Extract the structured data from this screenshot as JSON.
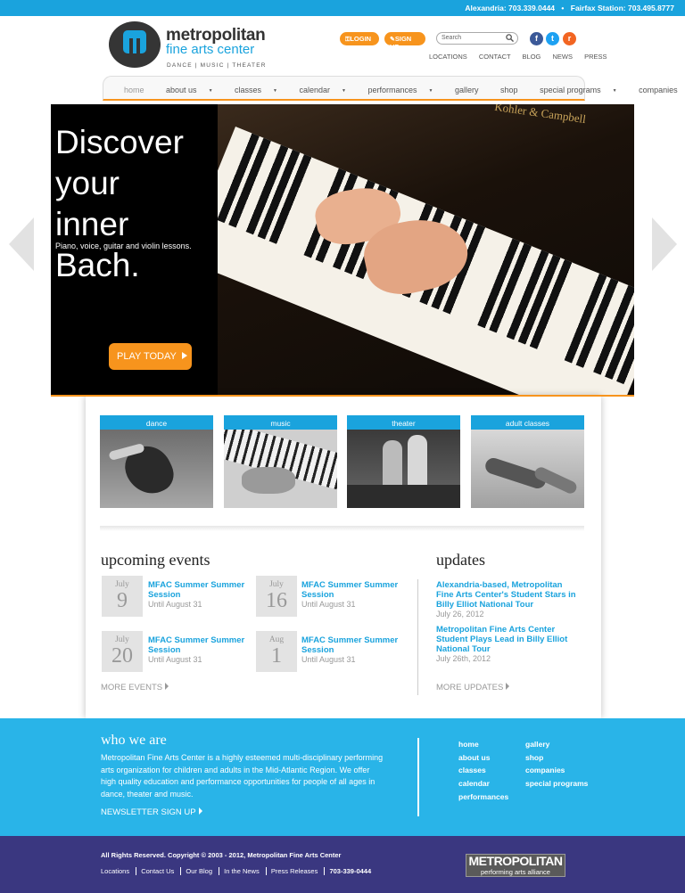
{
  "topbar": {
    "alexandria": "Alexandria: 703.339.0444",
    "separator": "•",
    "fairfax": "Fairfax Station: 703.495.8777"
  },
  "logo": {
    "name": "metropolitan",
    "subtitle": "fine arts center",
    "tagline": "DANCE | MUSIC | THEATER"
  },
  "header": {
    "login_label": "LOGIN",
    "signup_label": "SIGN UP",
    "search_placeholder": "Search",
    "social": {
      "facebook": "f",
      "twitter": "t",
      "rss": "r"
    },
    "util_links": [
      "LOCATIONS",
      "CONTACT",
      "BLOG",
      "NEWS",
      "PRESS"
    ]
  },
  "nav": {
    "items": [
      {
        "label": "home",
        "caret": ""
      },
      {
        "label": "about us",
        "caret": "▼"
      },
      {
        "label": "classes",
        "caret": "▼"
      },
      {
        "label": "calendar",
        "caret": "▼"
      },
      {
        "label": "performances",
        "caret": "▼"
      },
      {
        "label": "gallery",
        "caret": ""
      },
      {
        "label": "shop",
        "caret": ""
      },
      {
        "label": "special programs",
        "caret": "▼"
      },
      {
        "label": "companies",
        "caret": "▼"
      }
    ]
  },
  "hero": {
    "title_line1": "Discover",
    "title_line2": "your",
    "title_line3": "inner Bach.",
    "subtitle": "Piano, voice, guitar and violin lessons.",
    "cta_label": "PLAY TODAY",
    "piano_brand": "Kohler & Campbell"
  },
  "categories": [
    {
      "label": "dance"
    },
    {
      "label": "music"
    },
    {
      "label": "theater"
    },
    {
      "label": "adult classes"
    }
  ],
  "events": {
    "title": "upcoming events",
    "items": [
      {
        "month": "July",
        "day": "9",
        "title": "MFAC Summer Summer Session",
        "until": "Until August 31"
      },
      {
        "month": "July",
        "day": "16",
        "title": "MFAC Summer Summer Session",
        "until": "Until August 31"
      },
      {
        "month": "July",
        "day": "20",
        "title": "MFAC Summer Summer Session",
        "until": "Until August 31"
      },
      {
        "month": "Aug",
        "day": "1",
        "title": "MFAC Summer Summer Session",
        "until": "Until August 31"
      }
    ],
    "more_label": "MORE EVENTS"
  },
  "updates": {
    "title": "updates",
    "items": [
      {
        "title": "Alexandria-based, Metropolitan Fine Arts Center's Student Stars in Billy Elliot National Tour",
        "date": "July 26, 2012"
      },
      {
        "title": "Metropolitan Fine Arts Center Student Plays Lead in Billy Elliot National Tour",
        "date": "July 26th, 2012"
      }
    ],
    "more_label": "MORE UPDATES"
  },
  "who": {
    "title": "who we are",
    "text": "Metropolitan Fine Arts Center is a highly esteemed multi-disciplinary performing arts organization for children and adults in the Mid-Atlantic Region.  We offer high quality education and performance opportunities for people of all ages in dance, theater and music.",
    "newsletter_label": "NEWSLETTER SIGN UP",
    "links_col1": [
      "home",
      "about us",
      "classes",
      "calendar",
      "performances"
    ],
    "links_col2": [
      "gallery",
      "shop",
      "companies",
      "special programs"
    ]
  },
  "footer": {
    "copyright": "All Rights Reserved. Copyright © 2003 - 2012, Metropolitan Fine Arts Center",
    "links": [
      "Locations",
      "Contact Us",
      "Our Blog",
      "In the News",
      "Press Releases"
    ],
    "phone": "703-339-0444",
    "partner_name": "METROPOLITAN",
    "partner_sub": "performing arts alliance"
  },
  "colors": {
    "accent_blue": "#1aa3dd",
    "accent_orange": "#f7941d",
    "footer_purple": "#3a3780"
  }
}
